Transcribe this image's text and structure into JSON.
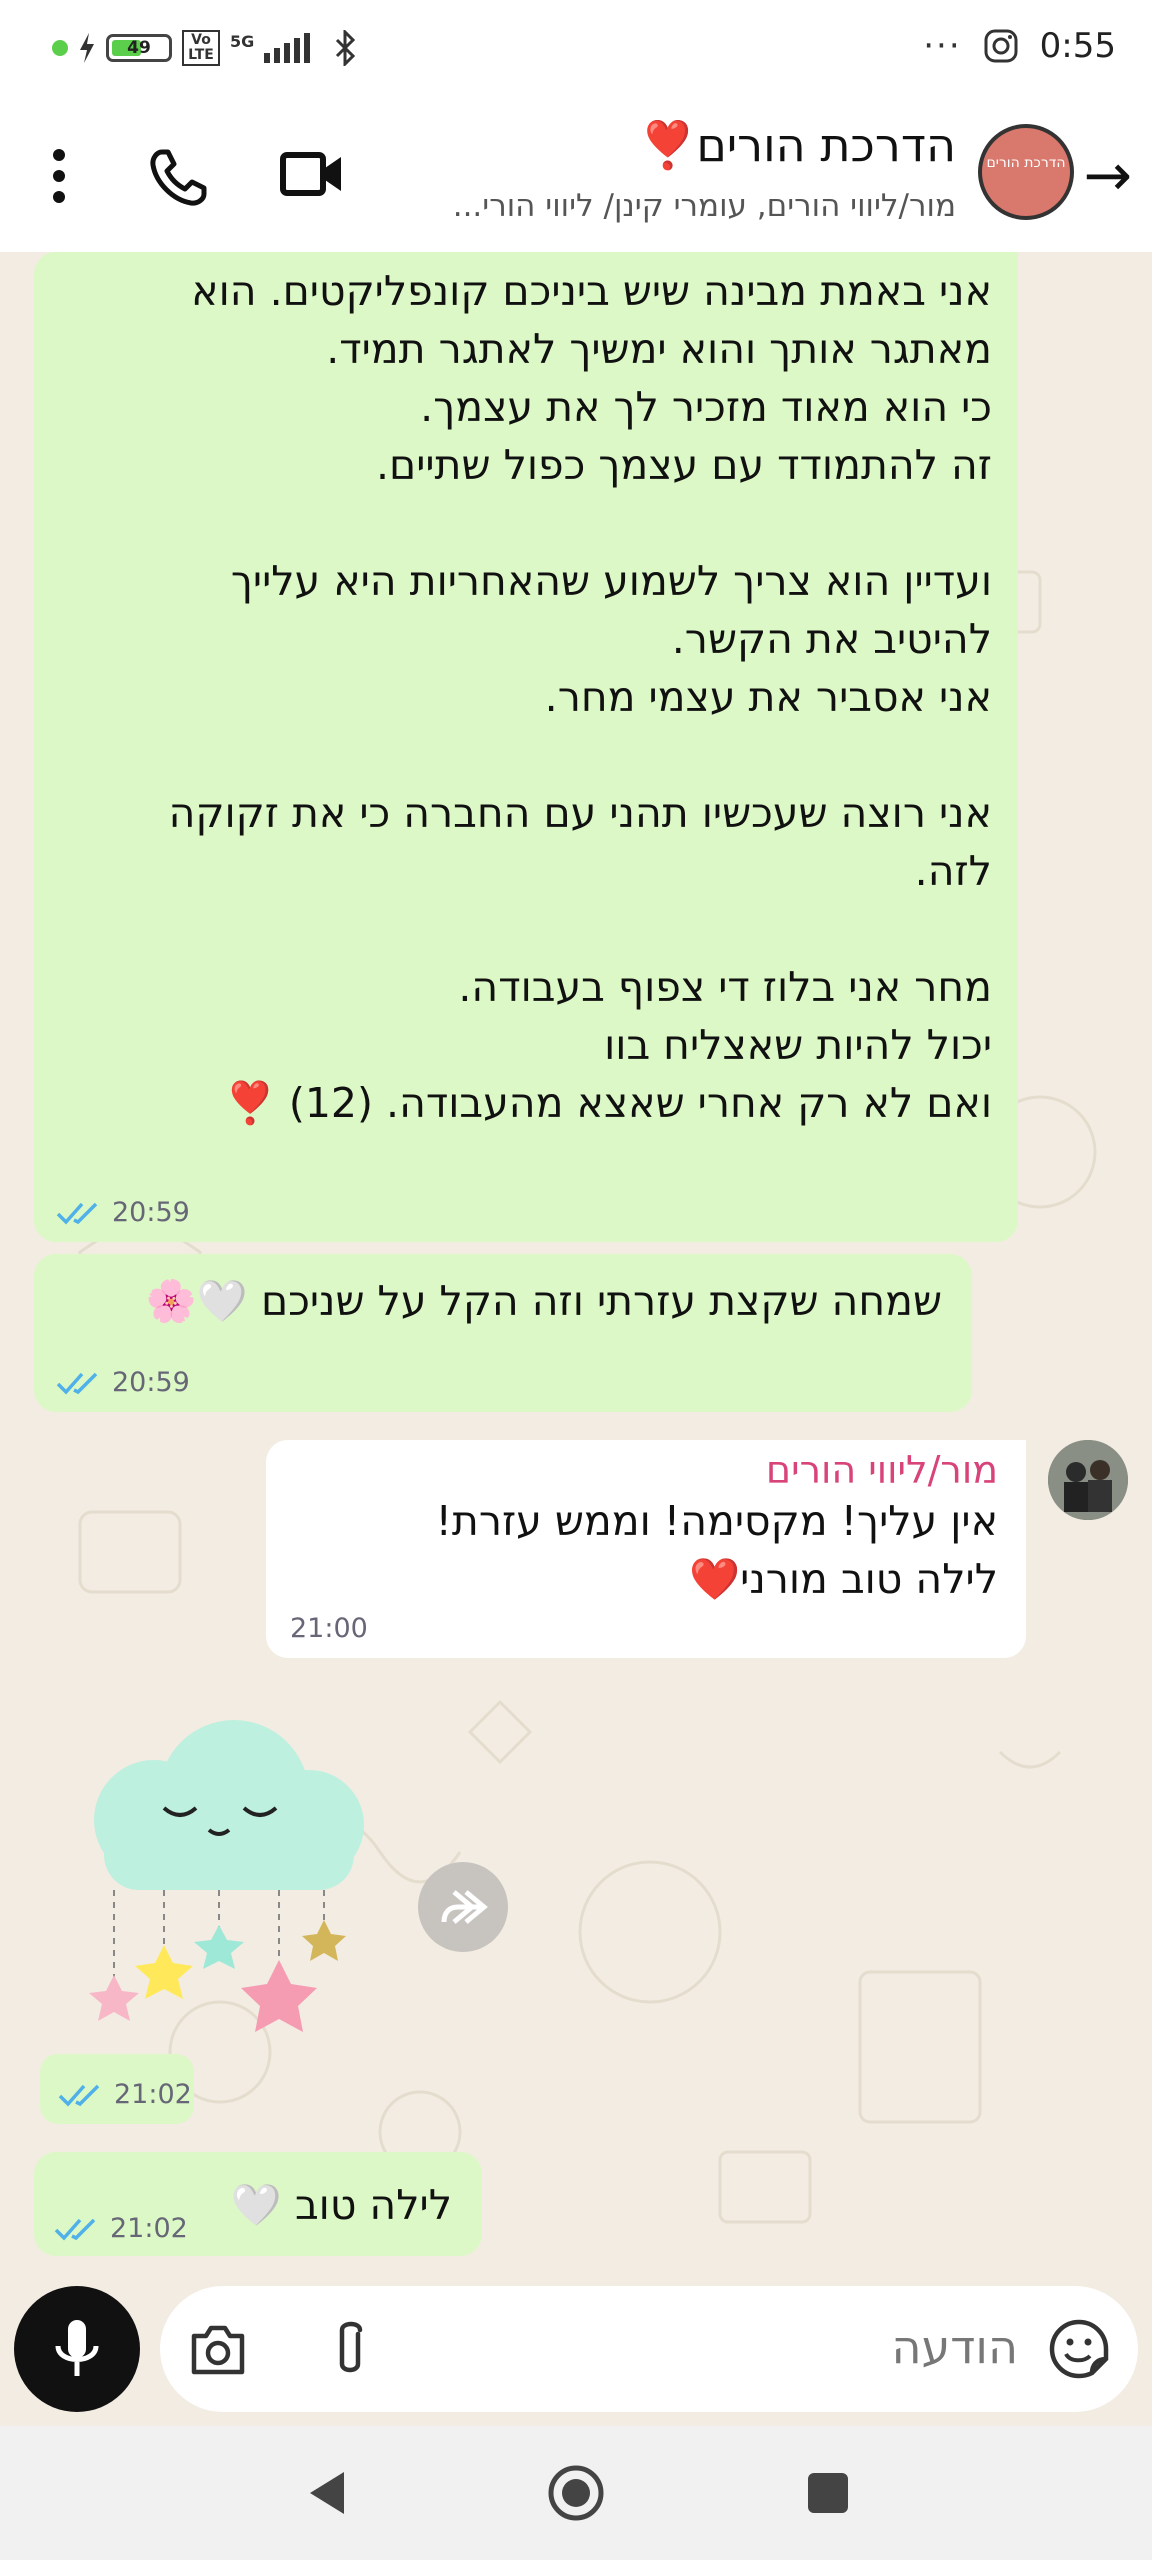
{
  "status_bar": {
    "battery_level": "49",
    "network_label": "5G",
    "volte_label": "Vo LTE",
    "time": "0:55",
    "overflow": "···"
  },
  "header": {
    "title": "הדרכת הורים",
    "title_emoji": "❣️",
    "subtitle": "מור/ליווי הורים, עומרי קינן/ ליווי הורי...",
    "avatar_text": "הדרכת הורים"
  },
  "messages": [
    {
      "text": "אני באמת מבינה שיש ביניכם קונפליקטים. הוא\nמאתגר אותך והוא ימשיך לאתגר תמיד.\nכי הוא מאוד מזכיר לך את עצמך.\nזה להתמודד עם עצמך כפול שתיים.\n\nועדיין הוא צריך לשמוע שהאחריות היא עלייך\nלהיטיב את הקשר.\nאני אסביר את עצמי מחר.\n\nאני רוצה שעכשיו תהני עם החברה כי את זקוקה\nלזה.\n\nמחר אני בלוז די צפוף בעבודה.\nיכול להיות שאצליח בוו\nואם לא רק אחרי שאצא מהעבודה. (12) ❣️",
      "time": "20:59"
    },
    {
      "text": "שמחה שקצת עזרתי וזה הקל על שניכם 🤍🌸",
      "time": "20:59"
    },
    {
      "sender": "מור/ליווי הורים",
      "text": "אין עליך! מקסימה! וממש עזרת!\nלילה טוב מורני❤️",
      "time": "21:00"
    },
    {
      "sticker": "sleeping-cloud-sticker",
      "time": "21:02"
    },
    {
      "text": "לילה טוב 🤍",
      "time": "21:02"
    }
  ],
  "composer": {
    "placeholder": "הודעה"
  },
  "colors": {
    "outgoing_bubble": "#dcf8c6",
    "incoming_bubble": "#ffffff",
    "chat_background": "#f3ece2",
    "read_ticks": "#4fb1e8",
    "sender_name": "#d8437a"
  }
}
